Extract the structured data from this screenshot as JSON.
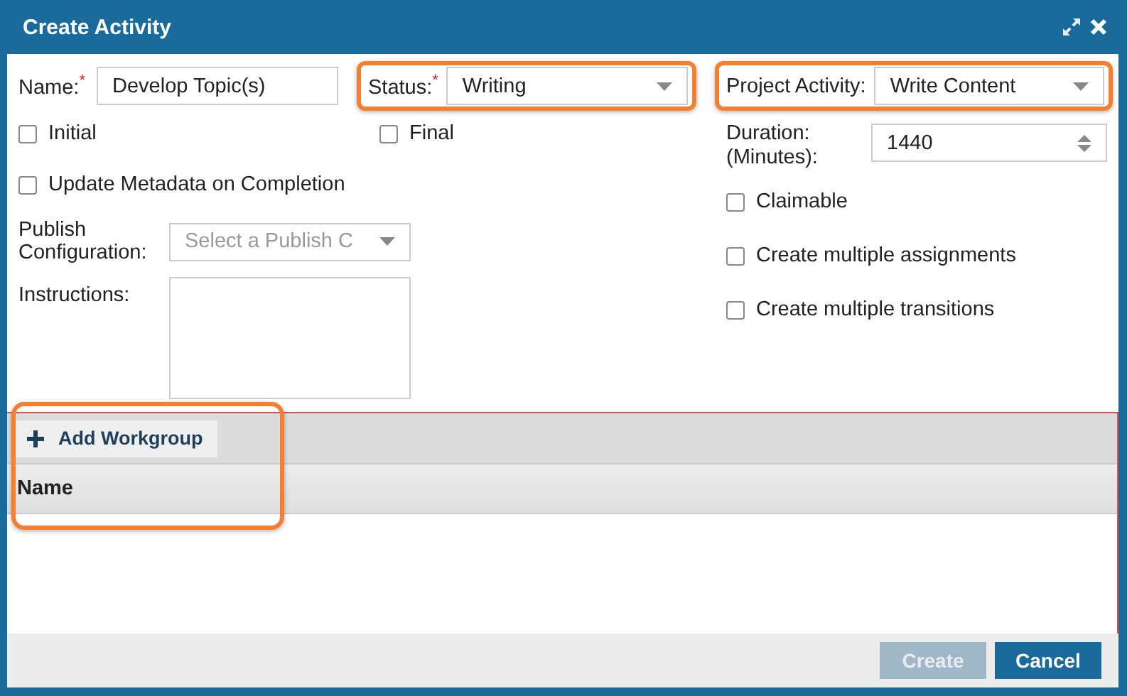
{
  "window": {
    "title": "Create Activity"
  },
  "form": {
    "name": {
      "label": "Name:",
      "required_mark": "*",
      "value": "Develop Topic(s)"
    },
    "status": {
      "label": "Status:",
      "required_mark": "*",
      "value": "Writing",
      "highlighted": true
    },
    "project_activity": {
      "label": "Project Activity:",
      "value": "Write Content",
      "highlighted": true
    },
    "flags": [
      {
        "label": "Initial",
        "checked": false
      },
      {
        "label": "Final",
        "checked": false
      }
    ],
    "update_metadata": {
      "label": "Update Metadata on Completion",
      "checked": false
    },
    "publish_configuration": {
      "label": "Publish Configuration:",
      "placeholder": "Select a Publish C"
    },
    "instructions": {
      "label": "Instructions:"
    },
    "duration": {
      "label": "Duration: (Minutes):",
      "value": "1440"
    },
    "options": [
      {
        "label": "Claimable",
        "checked": false
      },
      {
        "label": "Create multiple assignments",
        "checked": false
      },
      {
        "label": "Create multiple transitions",
        "checked": false
      }
    ]
  },
  "workgroups": {
    "add_button": "Add Workgroup",
    "highlighted": true,
    "columns": [
      "Name"
    ]
  },
  "buttons": [
    {
      "label": "Create",
      "disabled": true
    },
    {
      "label": "Cancel",
      "disabled": false
    }
  ]
}
